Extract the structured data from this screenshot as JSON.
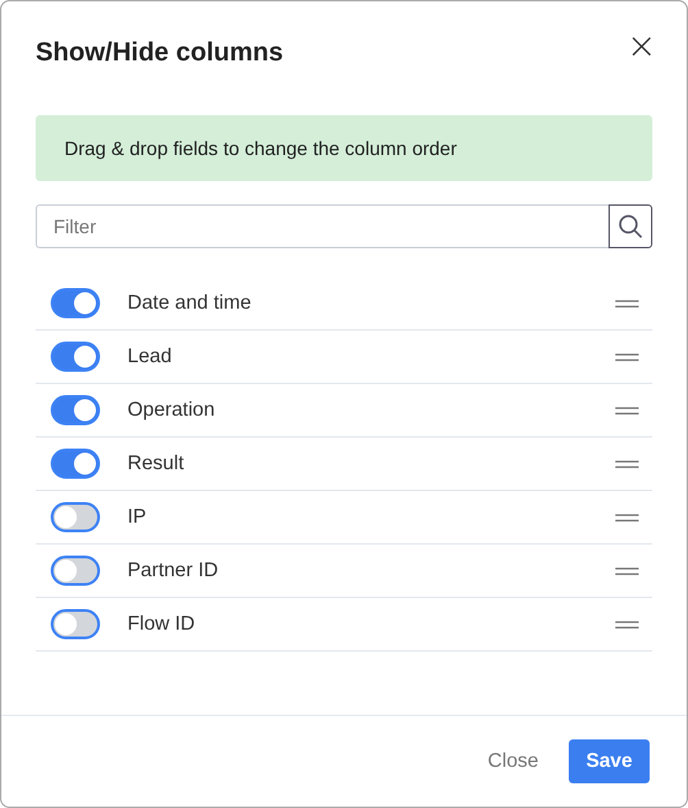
{
  "dialog": {
    "title": "Show/Hide columns",
    "close_icon": "×"
  },
  "notice": "Drag & drop fields to change the column order",
  "filter": {
    "placeholder": "Filter"
  },
  "columns": [
    {
      "label": "Date and time",
      "on": true
    },
    {
      "label": "Lead",
      "on": true
    },
    {
      "label": "Operation",
      "on": true
    },
    {
      "label": "Result",
      "on": true
    },
    {
      "label": "IP",
      "on": false
    },
    {
      "label": "Partner ID",
      "on": false
    },
    {
      "label": "Flow ID",
      "on": false
    }
  ],
  "buttons": {
    "close": "Close",
    "save": "Save"
  }
}
